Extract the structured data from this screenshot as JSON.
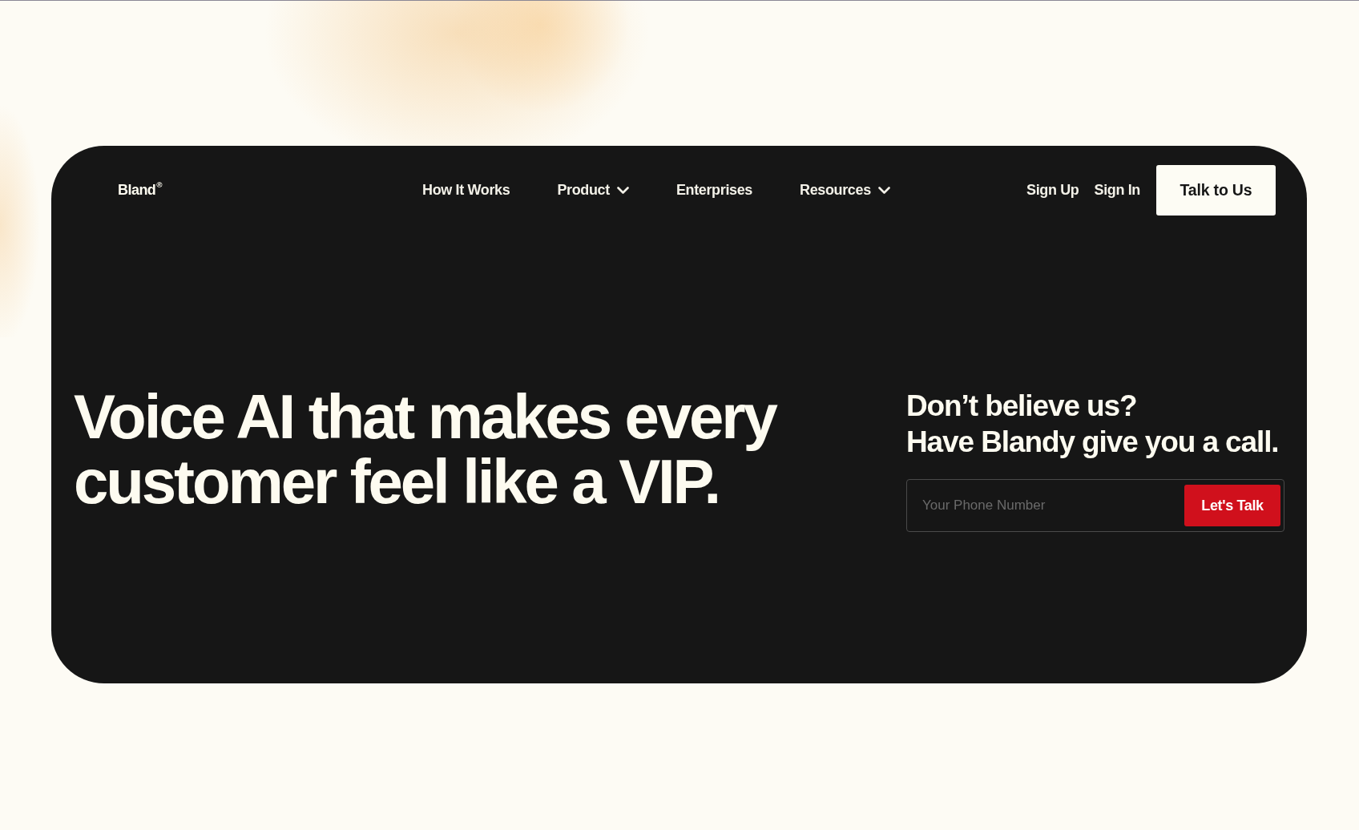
{
  "header": {
    "logo": "Bland$^{®}$",
    "nav_links": [
      {
        "label": "How It Works",
        "dropdown": false
      },
      {
        "label": "Product",
        "dropdown": true
      },
      {
        "label": "Enterprises",
        "dropdown": false
      },
      {
        "label": "Resources",
        "dropdown": true
      }
    ],
    "auth_links": [
      "Sign Up",
      "Sign In"
    ],
    "cta_button": "Talk to Us"
  },
  "hero": {
    "headline": "Voice AI that makes every customer feel like a VIP."
  },
  "callback": {
    "heading_lines": [
      "Don’t believe us?",
      "Have Blandy give you a call."
    ],
    "phone_field": {
      "placeholder": "Your Phone Number"
    },
    "submit_button": "Let's Talk"
  }
}
